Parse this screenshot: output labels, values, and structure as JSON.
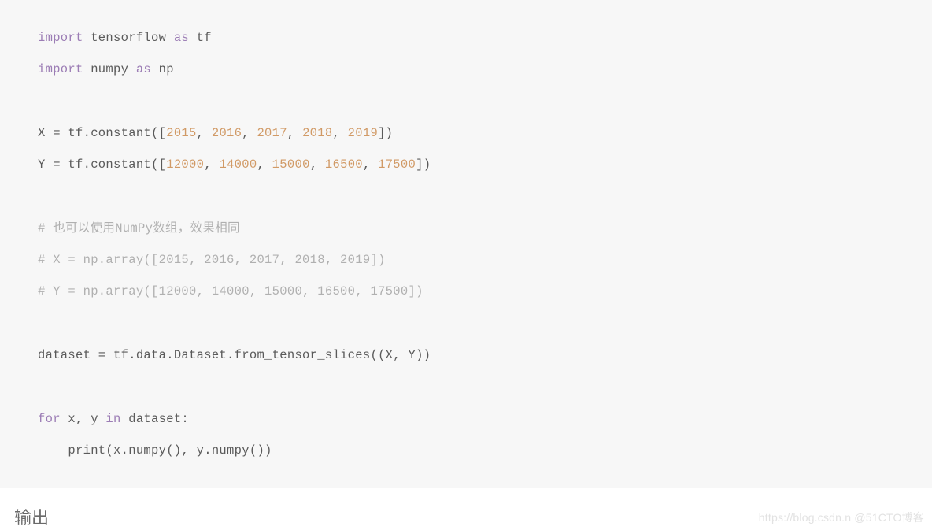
{
  "code": {
    "lines": [
      {
        "tokens": [
          {
            "cls": "kw",
            "t": "import"
          },
          {
            "cls": "plain",
            "t": " tensorflow "
          },
          {
            "cls": "kw",
            "t": "as"
          },
          {
            "cls": "plain",
            "t": " tf"
          }
        ]
      },
      {
        "tokens": [
          {
            "cls": "kw",
            "t": "import"
          },
          {
            "cls": "plain",
            "t": " numpy "
          },
          {
            "cls": "kw",
            "t": "as"
          },
          {
            "cls": "plain",
            "t": " np"
          }
        ]
      },
      {
        "tokens": [
          {
            "cls": "plain",
            "t": ""
          }
        ]
      },
      {
        "tokens": [
          {
            "cls": "plain",
            "t": "X = tf.constant(["
          },
          {
            "cls": "num",
            "t": "2015"
          },
          {
            "cls": "plain",
            "t": ", "
          },
          {
            "cls": "num",
            "t": "2016"
          },
          {
            "cls": "plain",
            "t": ", "
          },
          {
            "cls": "num",
            "t": "2017"
          },
          {
            "cls": "plain",
            "t": ", "
          },
          {
            "cls": "num",
            "t": "2018"
          },
          {
            "cls": "plain",
            "t": ", "
          },
          {
            "cls": "num",
            "t": "2019"
          },
          {
            "cls": "plain",
            "t": "])"
          }
        ]
      },
      {
        "tokens": [
          {
            "cls": "plain",
            "t": "Y = tf.constant(["
          },
          {
            "cls": "num",
            "t": "12000"
          },
          {
            "cls": "plain",
            "t": ", "
          },
          {
            "cls": "num",
            "t": "14000"
          },
          {
            "cls": "plain",
            "t": ", "
          },
          {
            "cls": "num",
            "t": "15000"
          },
          {
            "cls": "plain",
            "t": ", "
          },
          {
            "cls": "num",
            "t": "16500"
          },
          {
            "cls": "plain",
            "t": ", "
          },
          {
            "cls": "num",
            "t": "17500"
          },
          {
            "cls": "plain",
            "t": "])"
          }
        ]
      },
      {
        "tokens": [
          {
            "cls": "plain",
            "t": ""
          }
        ]
      },
      {
        "tokens": [
          {
            "cls": "cmt",
            "t": "# 也可以使用NumPy数组，效果相同"
          }
        ]
      },
      {
        "tokens": [
          {
            "cls": "cmt",
            "t": "# X = np.array([2015, 2016, 2017, 2018, 2019])"
          }
        ]
      },
      {
        "tokens": [
          {
            "cls": "cmt",
            "t": "# Y = np.array([12000, 14000, 15000, 16500, 17500])"
          }
        ]
      },
      {
        "tokens": [
          {
            "cls": "plain",
            "t": ""
          }
        ]
      },
      {
        "tokens": [
          {
            "cls": "plain",
            "t": "dataset = tf.data.Dataset.from_tensor_slices((X, Y))"
          }
        ]
      },
      {
        "tokens": [
          {
            "cls": "plain",
            "t": ""
          }
        ]
      },
      {
        "tokens": [
          {
            "cls": "kw",
            "t": "for"
          },
          {
            "cls": "plain",
            "t": " x, y "
          },
          {
            "cls": "kw",
            "t": "in"
          },
          {
            "cls": "plain",
            "t": " dataset:"
          }
        ]
      },
      {
        "tokens": [
          {
            "cls": "plain",
            "t": "    print(x.numpy(), y.numpy())"
          }
        ]
      }
    ]
  },
  "output_label": "输出",
  "watermark": "https://blog.csdn.n @51CTO博客"
}
